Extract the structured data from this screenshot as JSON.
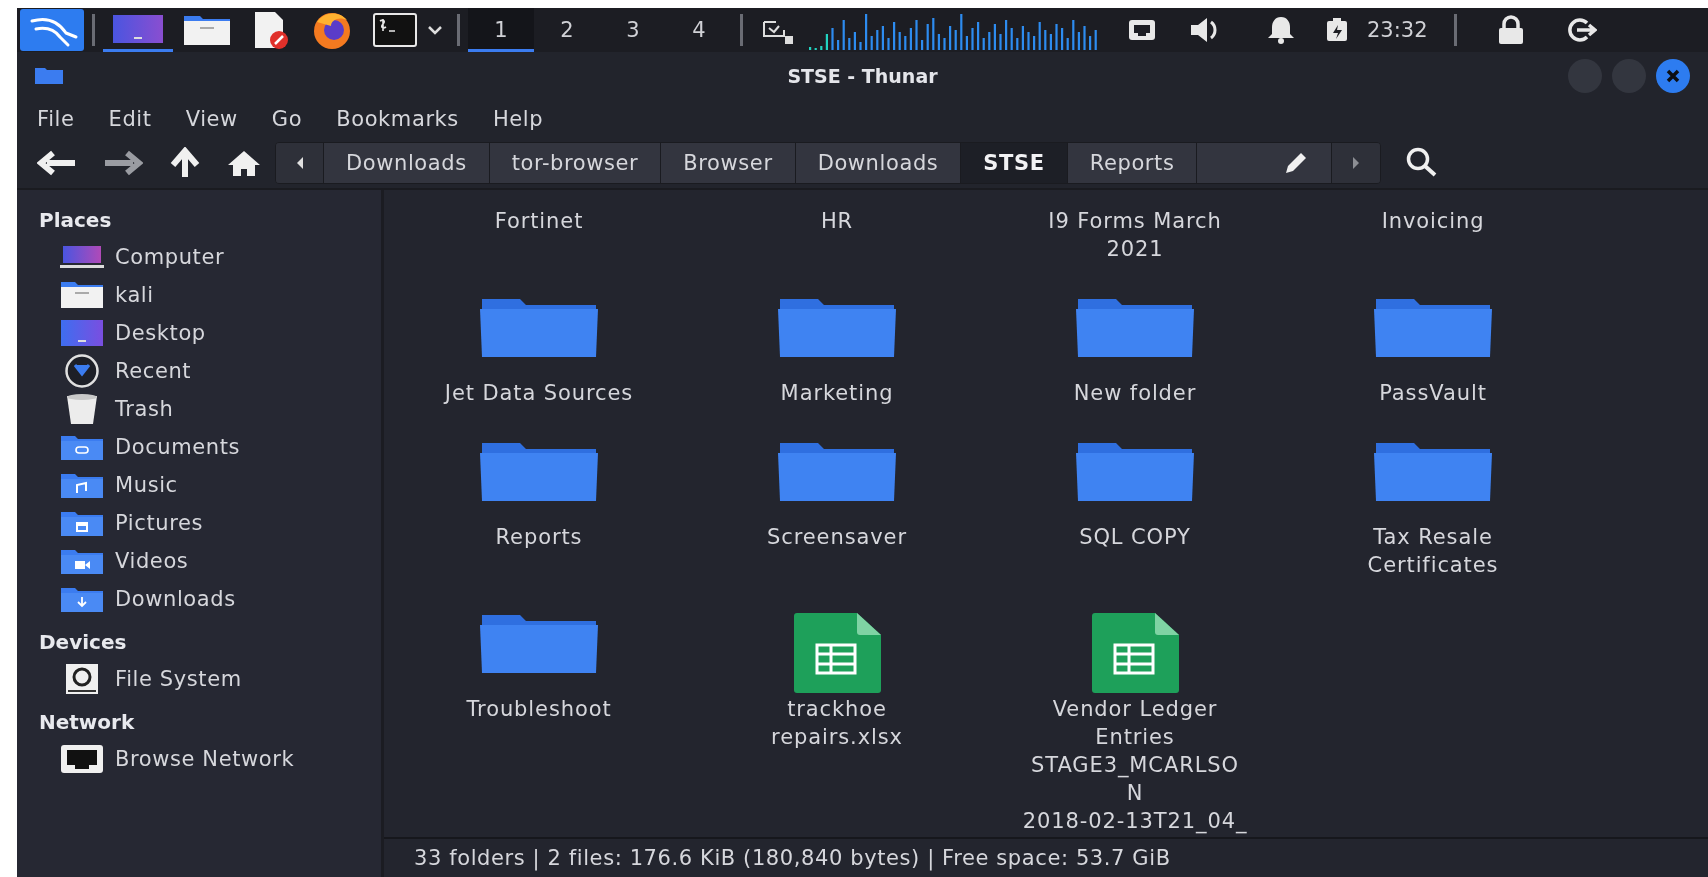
{
  "panel": {
    "workspaces": [
      {
        "label": "1",
        "selected": true
      },
      {
        "label": "2",
        "selected": false
      },
      {
        "label": "3",
        "selected": false
      },
      {
        "label": "4",
        "selected": false
      }
    ],
    "clock": "23:32"
  },
  "window": {
    "title": "STSE - Thunar"
  },
  "menu": [
    "File",
    "Edit",
    "View",
    "Go",
    "Bookmarks",
    "Help"
  ],
  "path_bar": {
    "crumbs": [
      {
        "label": "Downloads",
        "selected": false
      },
      {
        "label": "tor-browser",
        "selected": false
      },
      {
        "label": "Browser",
        "selected": false
      },
      {
        "label": "Downloads",
        "selected": false
      },
      {
        "label": "STSE",
        "selected": true
      },
      {
        "label": "Reports",
        "selected": false
      }
    ]
  },
  "sidebar": {
    "sections": [
      {
        "title": "Places",
        "items": [
          {
            "label": "Computer",
            "kind": "computer"
          },
          {
            "label": "kali",
            "kind": "home"
          },
          {
            "label": "Desktop",
            "kind": "desktop"
          },
          {
            "label": "Recent",
            "kind": "recent"
          },
          {
            "label": "Trash",
            "kind": "trash"
          },
          {
            "label": "Documents",
            "kind": "documents"
          },
          {
            "label": "Music",
            "kind": "music"
          },
          {
            "label": "Pictures",
            "kind": "pictures"
          },
          {
            "label": "Videos",
            "kind": "videos"
          },
          {
            "label": "Downloads",
            "kind": "downloads"
          }
        ]
      },
      {
        "title": "Devices",
        "items": [
          {
            "label": "File System",
            "kind": "drive"
          }
        ]
      },
      {
        "title": "Network",
        "items": [
          {
            "label": "Browse Network",
            "kind": "network"
          }
        ]
      }
    ]
  },
  "items": [
    {
      "name": "Fortinet"
    },
    {
      "name": "HR"
    },
    {
      "name": "I9 Forms March\n2021"
    },
    {
      "name": "Invoicing"
    },
    {
      "name": "Jet Data Sources",
      "kind": "folder"
    },
    {
      "name": "Marketing",
      "kind": "folder"
    },
    {
      "name": "New folder",
      "kind": "folder"
    },
    {
      "name": "PassVault",
      "kind": "folder"
    },
    {
      "name": "Reports",
      "kind": "folder"
    },
    {
      "name": "Screensaver",
      "kind": "folder"
    },
    {
      "name": "SQL COPY",
      "kind": "folder"
    },
    {
      "name": "Tax Resale\nCertificates",
      "kind": "folder"
    },
    {
      "name": "Troubleshoot",
      "kind": "folder"
    },
    {
      "name": "trackhoe\nrepairs.xlsx",
      "kind": "spreadsheet"
    },
    {
      "name": "Vendor Ledger\nEntries\nSTAGE3_MCARLSO\nN\n2018-02-13T21_04_",
      "kind": "spreadsheet"
    }
  ],
  "status_bar": "33 folders | 2 files: 176.6 KiB (180,840 bytes) | Free space: 53.7 GiB"
}
